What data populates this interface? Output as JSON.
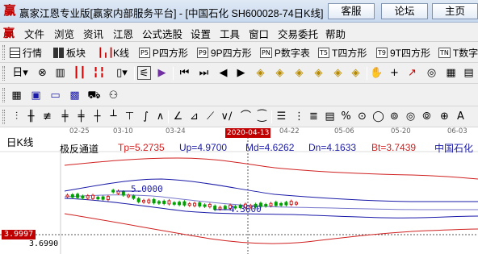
{
  "titlebar": {
    "logo": "赢",
    "title": "赢家江恩专业版[赢家内部服务平台] - [中国石化   SH600028-74日K线]",
    "buttons": [
      "客服",
      "论坛",
      "主页"
    ]
  },
  "menu": {
    "logo": "赢",
    "items": [
      "文件",
      "浏览",
      "资讯",
      "江恩",
      "公式选股",
      "设置",
      "工具",
      "窗口",
      "交易委托",
      "帮助"
    ]
  },
  "toolbar1": {
    "items": [
      {
        "icon": "grid-icon",
        "label": "行情"
      },
      {
        "icon": "block-icon",
        "label": "板块"
      },
      {
        "icon": "kline-icon",
        "label": "K线"
      },
      {
        "icon": "P5",
        "label": "P四方形"
      },
      {
        "icon": "P9",
        "label": "9P四方形"
      },
      {
        "icon": "PN",
        "label": "P数字表"
      },
      {
        "icon": "T5",
        "label": "T四方形"
      },
      {
        "icon": "T9",
        "label": "9T四方形"
      },
      {
        "icon": "TN",
        "label": "T数字"
      }
    ]
  },
  "timeaxis": {
    "ticks": [
      "02-25",
      "03-10",
      "03-24",
      "04-22",
      "05-06",
      "05-20",
      "06-03"
    ],
    "cursor_date": "2020-04-13"
  },
  "chart": {
    "kline_label": "日K线",
    "indicator_name": "极反通道",
    "tp": "Tp=5.2735",
    "up": "Up=4.9700",
    "md": "Md=4.6262",
    "dn": "Dn=4.1633",
    "bt": "Bt=3.7439",
    "stock_name": "中国石化",
    "price_tag": "3.9997",
    "price_label": "3.6990",
    "annot_high": "5.0000",
    "annot_low": "4.3600",
    "colors": {
      "upper_band": "#d02020",
      "mid_band": "#1a1aa8",
      "candle_up": "#d02020",
      "candle_down": "#00a000",
      "accent": "#c00000"
    }
  }
}
